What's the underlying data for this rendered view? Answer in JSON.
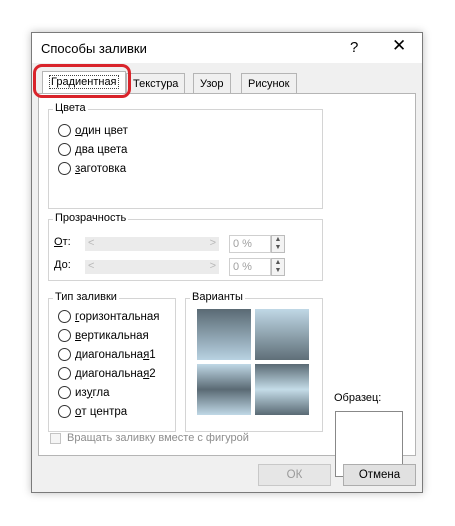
{
  "dialog": {
    "title": "Способы заливки",
    "help_glyph": "?",
    "close_glyph": "✕"
  },
  "tabs": [
    {
      "label": "Градиентная",
      "active": true
    },
    {
      "label": "Текстура",
      "active": false
    },
    {
      "label": "Узор",
      "active": false
    },
    {
      "label": "Рисунок",
      "active": false
    }
  ],
  "colors": {
    "label": "Цвета",
    "options": [
      {
        "underline": "о",
        "rest": "дин цвет"
      },
      {
        "underline": "д",
        "rest": "ва цвета"
      },
      {
        "underline": "з",
        "rest": "аготовка"
      }
    ]
  },
  "transparency": {
    "label": "Прозрачность",
    "from": {
      "underline": "О",
      "rest": "т:",
      "value": "0 %"
    },
    "to": {
      "underline": "Д",
      "rest": "о:",
      "value": "0 %"
    },
    "arrow_left": "<",
    "arrow_right": ">",
    "spin_up": "▲",
    "spin_down": "▼"
  },
  "fill_type": {
    "label": "Тип заливки",
    "options": [
      {
        "before": "",
        "underline": "г",
        "rest": "оризонтальная"
      },
      {
        "before": "",
        "underline": "в",
        "rest": "ертикальная"
      },
      {
        "before": "диагональна",
        "underline": "я",
        "rest": " 1"
      },
      {
        "before": "диагональна",
        "underline": "я",
        "rest": " 2"
      },
      {
        "before": "из ",
        "underline": "у",
        "rest": "гла"
      },
      {
        "before": "",
        "underline": "о",
        "rest": "т центра"
      }
    ]
  },
  "variants": {
    "before": "Варианты",
    "underline": "ы"
  },
  "sample": {
    "label": "Образец:"
  },
  "rotate_checkbox": {
    "label": "Вращать заливку вместе с фигурой",
    "checked": false
  },
  "buttons": {
    "ok": "ОК",
    "cancel": "Отмена"
  },
  "accent": {
    "highlight": "#d9242b"
  }
}
